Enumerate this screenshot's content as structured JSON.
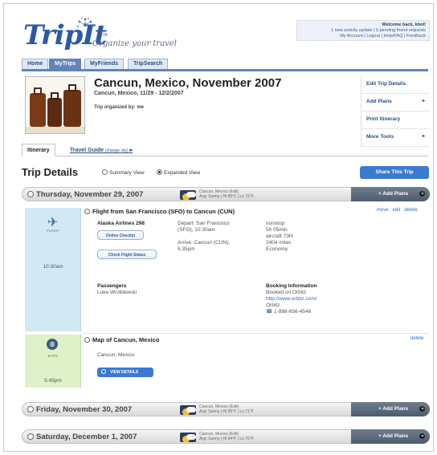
{
  "header": {
    "logo_text": "TripIt",
    "beta": "BETA",
    "tagline": "Organize your travel",
    "welcome": "Welcome back, kbot!",
    "activity": "1 new activity update | 0 pending friend requests",
    "links": "My Account | Logout | Help/FAQ | Feedback"
  },
  "nav": {
    "tabs": [
      "Home",
      "MyTrips",
      "MyFriends",
      "TripSearch"
    ],
    "active": "MyTrips"
  },
  "trip": {
    "title": "Cancun, Mexico, November 2007",
    "subtitle": "Cancun, Mexico, 11/29 - 12/2/2007",
    "organizer": "Trip organized by: me"
  },
  "side_menu": {
    "edit": "Edit Trip Details",
    "add_plans": "Add Plans",
    "print": "Print Itinerary",
    "more_tools": "More Tools"
  },
  "subtabs": {
    "itinerary": "Itinerary",
    "travel_guide": "Travel Guide",
    "change_city": "(change city)"
  },
  "details": {
    "title": "Trip Details",
    "summary_view": "Summary View",
    "expanded_view": "Expanded View",
    "share": "Share This Trip"
  },
  "days": [
    {
      "label": "Thursday, November 29, 2007",
      "weather_loc": "Cancun, Mexico (Edit)",
      "weather": "Avg: Sunny | Hi 85°F | Lo 72°F",
      "add": "+ Add Plans"
    },
    {
      "label": "Friday, November 30, 2007",
      "weather_loc": "Cancun, Mexico (Edit)",
      "weather": "Avg: Sunny | Hi 85°F | Lo 71°F",
      "add": "+ Add Plans"
    },
    {
      "label": "Saturday, December 1, 2007",
      "weather_loc": "Cancun, Mexico (Edit)",
      "weather": "Avg: Sunny | Hi 84°F | Lo 70°F",
      "add": "+ Add Plans"
    }
  ],
  "flight": {
    "type_label": "FLIGHT",
    "time": "10:30am",
    "title": "Flight from San Francisco (SFO) to Cancun (CUN)",
    "actions": "move : edit : delete",
    "airline": "Alaska Airlines 298",
    "online_checkin": "Online Checkin",
    "check_status": "Check Flight Status",
    "depart_1": "Depart: San Francisco",
    "depart_2": "(SFO), 10:30am",
    "arrive_1": "Arrive: Cancun (CUN),",
    "arrive_2": "5:35pm",
    "stops": "nonstop",
    "duration": "5h 05min",
    "aircraft": "aircraft 73H",
    "distance": "2404 miles",
    "cabin": "Economy",
    "passengers_label": "Passengers",
    "passenger": "Luke Wroblewski",
    "booking_label": "Booking Information",
    "booked_on": "Booked on Orbitz",
    "booking_url": "http://www.orbitz.com/",
    "booking_agent": "Orbitz",
    "booking_phone": "1-888-656-4546"
  },
  "map": {
    "type_label": "MAPS",
    "time": "5:45pm",
    "title": "Map of Cancun, Mexico",
    "actions": "delete",
    "location": "Cancun, Mexico",
    "view_details": "VIEW DETAILS"
  }
}
